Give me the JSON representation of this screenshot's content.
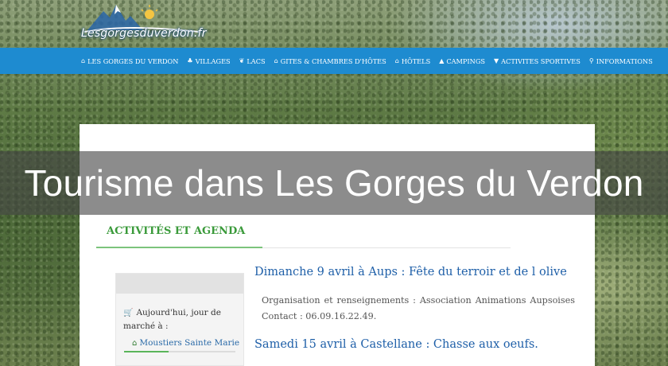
{
  "logo": {
    "text": "Lesgorgesduverdon.fr"
  },
  "nav": {
    "items": [
      {
        "label": "LES GORGES DU VERDON",
        "icon": "home-icon",
        "glyph": "⌂"
      },
      {
        "label": "VILLAGES",
        "icon": "bell-icon",
        "glyph": "♣"
      },
      {
        "label": "LACS",
        "icon": "leaf-icon",
        "glyph": "❦"
      },
      {
        "label": "GITES & CHAMBRES D'HÔTES",
        "icon": "home-icon",
        "glyph": "⌂"
      },
      {
        "label": "HÔTELS",
        "icon": "home-icon",
        "glyph": "⌂"
      },
      {
        "label": "CAMPINGS",
        "icon": "tent-icon",
        "glyph": "▲"
      },
      {
        "label": "ACTIVITES SPORTIVES",
        "icon": "filter-icon",
        "glyph": "▼"
      },
      {
        "label": "INFORMATIONS",
        "icon": "search-icon",
        "glyph": "⚲"
      }
    ]
  },
  "banner": {
    "title": "Tourisme dans Les Gorges du Verdon"
  },
  "section": {
    "title": "ACTIVITÉS ET AGENDA"
  },
  "sidebar": {
    "text": "Aujourd'hui, jour de marché à :",
    "link": "Moustiers Sainte Marie"
  },
  "events": [
    {
      "title": "Dimanche 9 avril à Aups : Fête du terroir et de l olive",
      "desc": "Organisation et renseignements : Association Animations Aupsoises Contact : 06.09.16.22.49."
    },
    {
      "title": "Samedi 15 avril à Castellane : Chasse aux oeufs."
    }
  ],
  "colors": {
    "nav_bg": "#1e8bd0",
    "accent_green": "#3a9a3a",
    "link_blue": "#1e5fa8"
  }
}
